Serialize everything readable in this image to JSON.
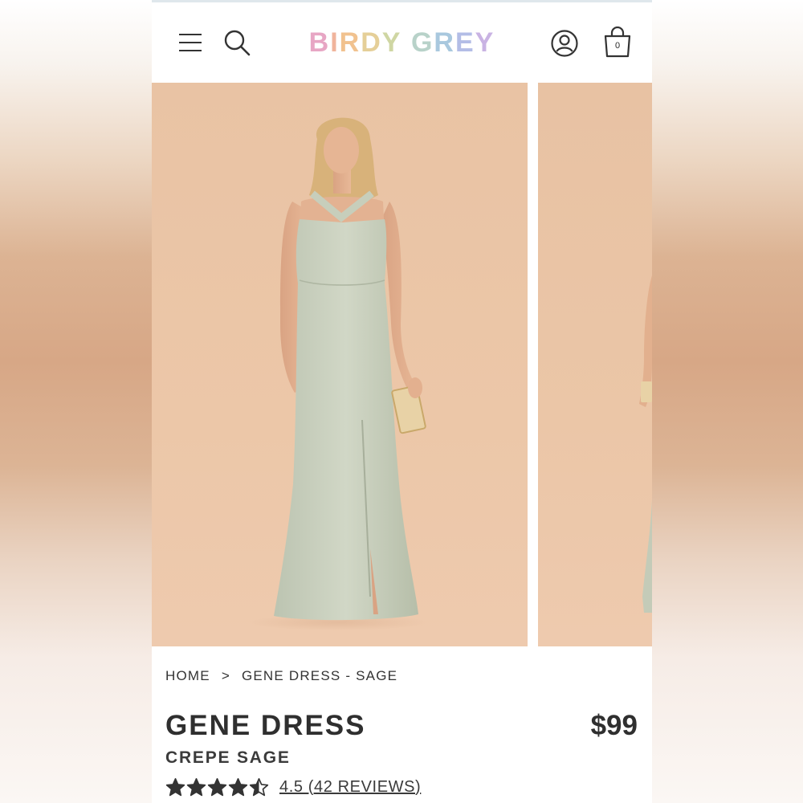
{
  "header": {
    "logo_letters": [
      {
        "char": "B",
        "color": "#e7a6c4"
      },
      {
        "char": "I",
        "color": "#f0b49c"
      },
      {
        "char": "R",
        "color": "#f1c28f"
      },
      {
        "char": "D",
        "color": "#e5cf98"
      },
      {
        "char": "Y",
        "color": "#cfd6a3"
      },
      {
        "char": " ",
        "color": "#ffffff"
      },
      {
        "char": "G",
        "color": "#b8d2c9"
      },
      {
        "char": "R",
        "color": "#a9c8de"
      },
      {
        "char": "E",
        "color": "#b3bde6"
      },
      {
        "char": "Y",
        "color": "#c9b3e3"
      }
    ],
    "icons": {
      "menu": "hamburger-menu-icon",
      "search": "search-icon",
      "account": "user-account-icon",
      "bag": "shopping-bag-icon"
    },
    "bag_count": "0"
  },
  "breadcrumb": {
    "home": "HOME",
    "separator": ">",
    "current": "GENE DRESS - SAGE"
  },
  "product": {
    "title": "GENE DRESS",
    "price": "$99",
    "variant": "CREPE SAGE",
    "rating_value": 4.5,
    "rating_max": 5,
    "rating_text": "4.5 (42 REVIEWS)"
  },
  "colors": {
    "dress_sage": "#c9d0be",
    "photo_backdrop": "#ebc6a7",
    "text_dark": "#2f2f2f"
  }
}
